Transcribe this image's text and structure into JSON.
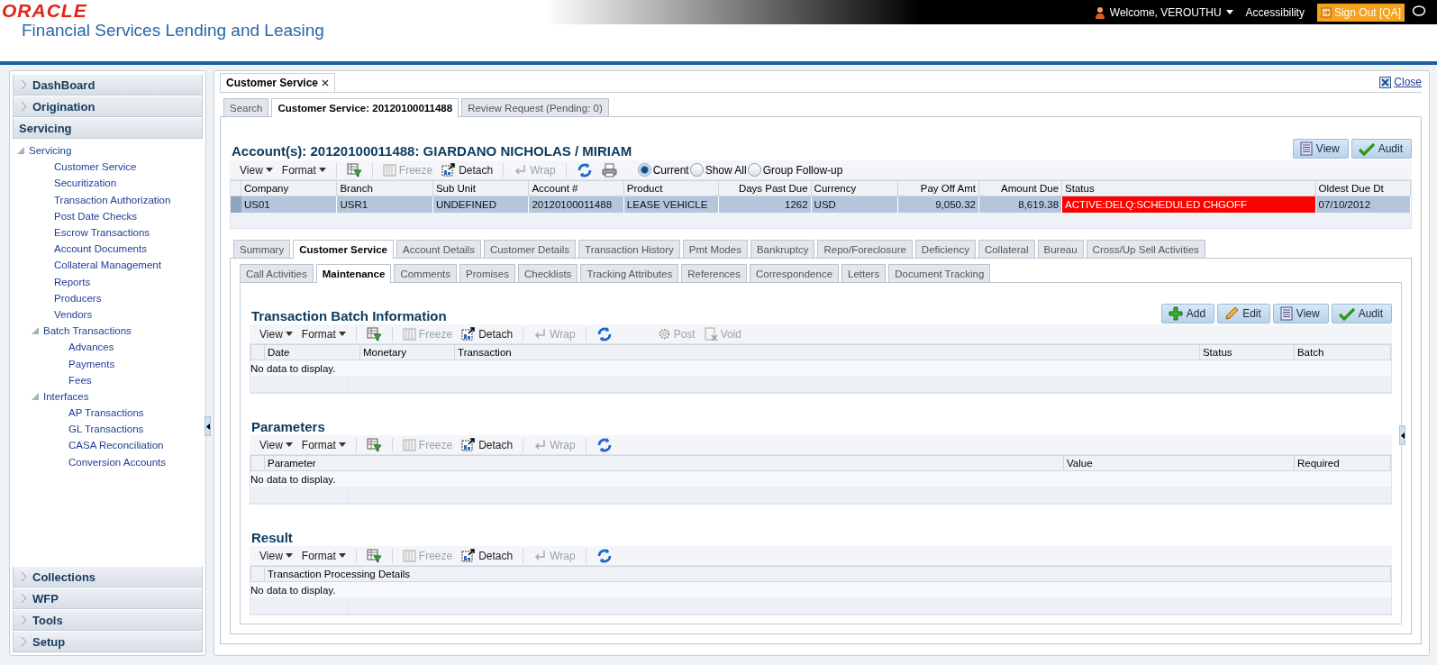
{
  "header": {
    "logo": "ORACLE",
    "product": "Financial Services Lending and Leasing",
    "welcome": "Welcome, VEROUTHU",
    "accessibility": "Accessibility",
    "sign_out": "Sign Out [QA]"
  },
  "sidebar": {
    "sections": [
      {
        "label": "DashBoard",
        "expanded": false
      },
      {
        "label": "Origination",
        "expanded": false
      },
      {
        "label": "Servicing",
        "expanded": true,
        "tree": [
          {
            "label": "Servicing",
            "expanded": true,
            "children": [
              {
                "label": "Customer Service"
              },
              {
                "label": "Securitization"
              },
              {
                "label": "Transaction Authorization"
              },
              {
                "label": "Post Date Checks"
              },
              {
                "label": "Escrow Transactions"
              },
              {
                "label": "Account Documents"
              },
              {
                "label": "Collateral Management"
              },
              {
                "label": "Reports"
              },
              {
                "label": "Producers"
              },
              {
                "label": "Vendors"
              },
              {
                "label": "Batch Transactions",
                "expanded": true,
                "children": [
                  {
                    "label": "Advances"
                  },
                  {
                    "label": "Payments"
                  },
                  {
                    "label": "Fees"
                  }
                ]
              },
              {
                "label": "Interfaces",
                "expanded": true,
                "children": [
                  {
                    "label": "AP Transactions"
                  },
                  {
                    "label": "GL Transactions"
                  },
                  {
                    "label": "CASA Reconciliation"
                  },
                  {
                    "label": "Conversion Accounts"
                  }
                ]
              }
            ]
          }
        ]
      },
      {
        "label": "Collections",
        "expanded": false
      },
      {
        "label": "WFP",
        "expanded": false
      },
      {
        "label": "Tools",
        "expanded": false
      },
      {
        "label": "Setup",
        "expanded": false
      }
    ]
  },
  "workspace": {
    "tab": "Customer Service",
    "close": "Close",
    "tabs": [
      {
        "label": "Search",
        "selected": false
      },
      {
        "label": "Customer Service: 20120100011488",
        "selected": true
      },
      {
        "label": "Review Request (Pending: 0)",
        "selected": false
      }
    ],
    "account": {
      "title": "Account(s): 20120100011488: GIARDANO NICHOLAS / MIRIAM",
      "buttons": [
        {
          "kind": "view",
          "label": "View"
        },
        {
          "kind": "audit",
          "label": "Audit"
        }
      ],
      "toolbar": [
        {
          "kind": "menu",
          "label": "View"
        },
        {
          "kind": "menu",
          "label": "Format"
        },
        {
          "kind": "filter",
          "disabled": false
        },
        {
          "kind": "freeze",
          "label": "Freeze",
          "disabled": true
        },
        {
          "kind": "detach",
          "label": "Detach",
          "disabled": false
        },
        {
          "kind": "wrap",
          "label": "Wrap",
          "disabled": true
        },
        {
          "kind": "refresh",
          "disabled": false
        },
        {
          "kind": "print",
          "disabled": false
        },
        {
          "kind": "radio",
          "label": "Current",
          "selected": true
        },
        {
          "kind": "radio",
          "label": "Show All",
          "selected": false
        },
        {
          "kind": "radio",
          "label": "Group Follow-up",
          "selected": false
        }
      ],
      "columns": [
        {
          "label": "Company",
          "kind": "text"
        },
        {
          "label": "Branch",
          "kind": "text"
        },
        {
          "label": "Sub Unit",
          "kind": "text"
        },
        {
          "label": "Account #",
          "kind": "text"
        },
        {
          "label": "Product",
          "kind": "text"
        },
        {
          "label": "Days Past Due",
          "kind": "number"
        },
        {
          "label": "Currency",
          "kind": "text"
        },
        {
          "label": "Pay Off Amt",
          "kind": "number"
        },
        {
          "label": "Amount Due",
          "kind": "number"
        },
        {
          "label": "Status",
          "kind": "status"
        },
        {
          "label": "Oldest Due Dt",
          "kind": "text"
        }
      ],
      "rows": [
        {
          "selected": true,
          "alert": true,
          "cells": [
            "US01",
            "USR1",
            "UNDEFINED",
            "20120100011488",
            "LEASE VEHICLE",
            "1262",
            "USD",
            "9,050.32",
            "8,619.38",
            "ACTIVE:DELQ:SCHEDULED CHGOFF",
            "07/10/2012"
          ]
        }
      ]
    },
    "detail_tabs": [
      {
        "label": "Summary",
        "selected": false
      },
      {
        "label": "Customer Service",
        "selected": true
      },
      {
        "label": "Account Details",
        "selected": false
      },
      {
        "label": "Customer Details",
        "selected": false
      },
      {
        "label": "Transaction History",
        "selected": false
      },
      {
        "label": "Pmt Modes",
        "selected": false
      },
      {
        "label": "Bankruptcy",
        "selected": false
      },
      {
        "label": "Repo/Foreclosure",
        "selected": false
      },
      {
        "label": "Deficiency",
        "selected": false
      },
      {
        "label": "Collateral",
        "selected": false
      },
      {
        "label": "Bureau",
        "selected": false
      },
      {
        "label": "Cross/Up Sell Activities",
        "selected": false
      }
    ],
    "sub_tabs": [
      {
        "label": "Call Activities",
        "selected": false
      },
      {
        "label": "Maintenance",
        "selected": true
      },
      {
        "label": "Comments",
        "selected": false
      },
      {
        "label": "Promises",
        "selected": false
      },
      {
        "label": "Checklists",
        "selected": false
      },
      {
        "label": "Tracking Attributes",
        "selected": false
      },
      {
        "label": "References",
        "selected": false
      },
      {
        "label": "Correspondence",
        "selected": false
      },
      {
        "label": "Letters",
        "selected": false
      },
      {
        "label": "Document Tracking",
        "selected": false
      }
    ],
    "sections": [
      {
        "title": "Transaction Batch Information",
        "buttons": [
          {
            "kind": "add",
            "label": "Add"
          },
          {
            "kind": "edit",
            "label": "Edit"
          },
          {
            "kind": "view",
            "label": "View"
          },
          {
            "kind": "audit",
            "label": "Audit"
          }
        ],
        "toolbar": [
          {
            "kind": "menu",
            "label": "View"
          },
          {
            "kind": "menu",
            "label": "Format"
          },
          {
            "kind": "filter",
            "disabled": false
          },
          {
            "kind": "freeze",
            "label": "Freeze",
            "disabled": true
          },
          {
            "kind": "detach",
            "label": "Detach",
            "disabled": false
          },
          {
            "kind": "wrap",
            "label": "Wrap",
            "disabled": true
          },
          {
            "kind": "refresh",
            "disabled": false
          },
          {
            "kind": "post",
            "label": "Post",
            "disabled": true
          },
          {
            "kind": "void",
            "label": "Void",
            "disabled": true
          }
        ],
        "columns": [
          "Date",
          "Monetary",
          "Transaction",
          "Status",
          "Batch"
        ],
        "empty_text": "No data to display."
      },
      {
        "title": "Parameters",
        "toolbar": [
          {
            "kind": "menu",
            "label": "View"
          },
          {
            "kind": "menu",
            "label": "Format"
          },
          {
            "kind": "filter",
            "disabled": false
          },
          {
            "kind": "freeze",
            "label": "Freeze",
            "disabled": true
          },
          {
            "kind": "detach",
            "label": "Detach",
            "disabled": false
          },
          {
            "kind": "wrap",
            "label": "Wrap",
            "disabled": true
          },
          {
            "kind": "refresh",
            "disabled": false
          }
        ],
        "columns": [
          "Parameter",
          "Value",
          "Required"
        ],
        "empty_text": "No data to display."
      },
      {
        "title": "Result",
        "toolbar": [
          {
            "kind": "menu",
            "label": "View"
          },
          {
            "kind": "menu",
            "label": "Format"
          },
          {
            "kind": "filter",
            "disabled": false
          },
          {
            "kind": "freeze",
            "label": "Freeze",
            "disabled": true
          },
          {
            "kind": "detach",
            "label": "Detach",
            "disabled": false
          },
          {
            "kind": "wrap",
            "label": "Wrap",
            "disabled": true
          },
          {
            "kind": "refresh",
            "disabled": false
          }
        ],
        "columns": [
          "Transaction Processing Details"
        ],
        "empty_text": "No data to display."
      }
    ]
  }
}
